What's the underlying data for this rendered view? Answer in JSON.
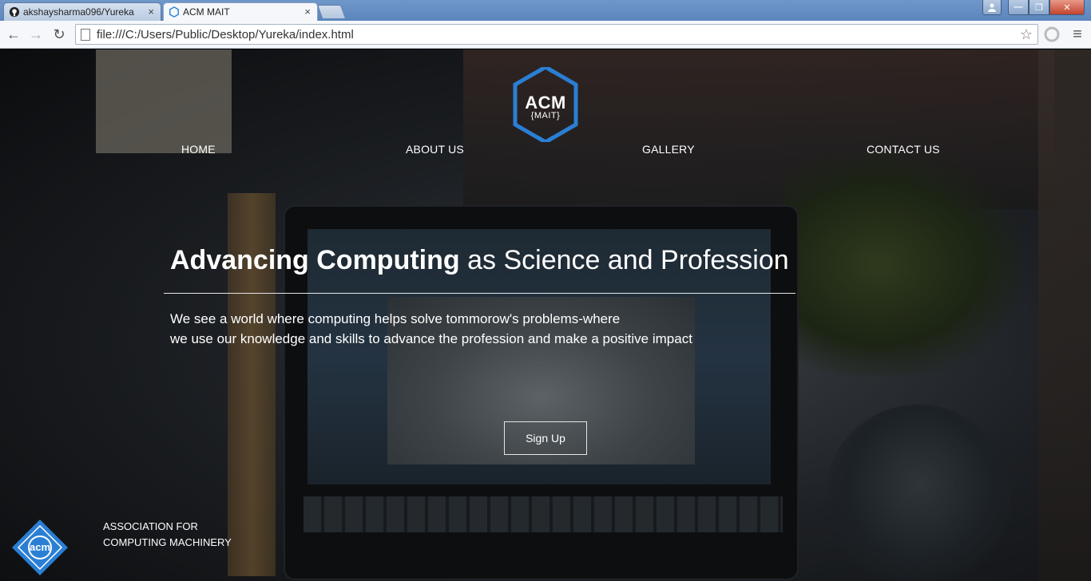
{
  "browser": {
    "tabs": [
      {
        "title": "akshaysharma096/Yureka",
        "close": "×"
      },
      {
        "title": "ACM MAIT",
        "close": "×"
      }
    ],
    "url": "file:///C:/Users/Public/Desktop/Yureka/index.html",
    "nav": {
      "back": "←",
      "forward": "→",
      "reload": "↻",
      "star": "☆",
      "menu": "≡"
    },
    "window_controls": {
      "minimize": "—",
      "maximize": "❐",
      "close": "✕"
    }
  },
  "site": {
    "logo": {
      "main": "ACM",
      "sub": "{MAIT}"
    },
    "nav": [
      "HOME",
      "ABOUT US",
      "GALLERY",
      "CONTACT US"
    ],
    "hero": {
      "heading_bold": "Advancing Computing",
      "heading_rest": " as Science and Profession",
      "line1": "We see a world where computing helps solve tommorow's problems-where",
      "line2": "we use our knowledge and skills to advance the profession and make a positive impact",
      "button": "Sign Up"
    },
    "footer": {
      "logo_text": "acm",
      "line1": "ASSOCIATION FOR",
      "line2": "COMPUTING MACHINERY"
    }
  },
  "colors": {
    "accent_blue": "#2a7fd4",
    "chrome_blue": "#6f97c9",
    "text": "#ffffff"
  }
}
